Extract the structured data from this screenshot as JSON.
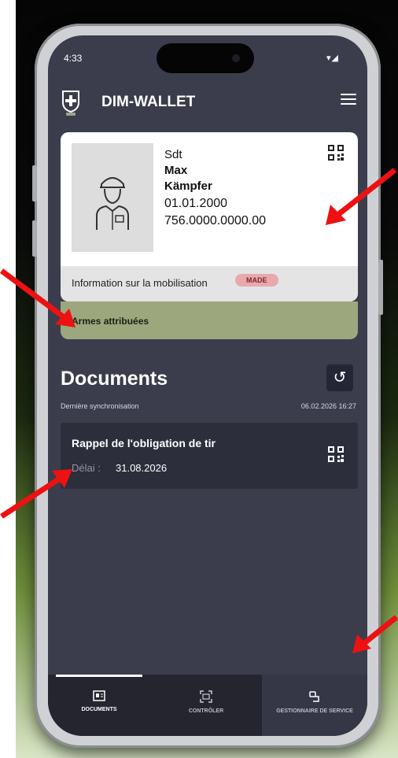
{
  "status_bar": {
    "time": "4:33",
    "icons": "▾◢"
  },
  "header": {
    "title": "DIM-WALLET",
    "logo_icon": "swiss-cross-shield-icon",
    "menu_icon": "hamburger-menu-icon"
  },
  "id_card": {
    "rank": "Sdt",
    "first_name": "Max",
    "last_name": "Kämpfer",
    "birthdate": "01.01.2000",
    "ahv_number": "756.0000.0000.00",
    "mobilization_label": "Information sur la mobilisation",
    "mobilization_badge": "MADE",
    "weapons_label": "Armes attribuées"
  },
  "documents": {
    "title": "Documents",
    "sync_label": "Dernière synchronisation",
    "sync_time": "06.02.2026 16:27",
    "items": [
      {
        "title": "Rappel de l'obligation de tir",
        "deadline_label": "Délai :",
        "deadline_value": "31.08.2026"
      }
    ]
  },
  "nav": {
    "items": [
      {
        "label": "DOCUMENTS",
        "active": true
      },
      {
        "label": "CONTRÔLER",
        "active": false
      },
      {
        "label": "GESTIONNAIRE DE SERVICE",
        "active": false
      }
    ]
  },
  "colors": {
    "screen_bg": "#3b3d4d",
    "card_bg": "#ffffff",
    "weapons_bg": "#9da77e",
    "badge_bg": "#e8a8ad",
    "arrow": "#ee1111"
  }
}
